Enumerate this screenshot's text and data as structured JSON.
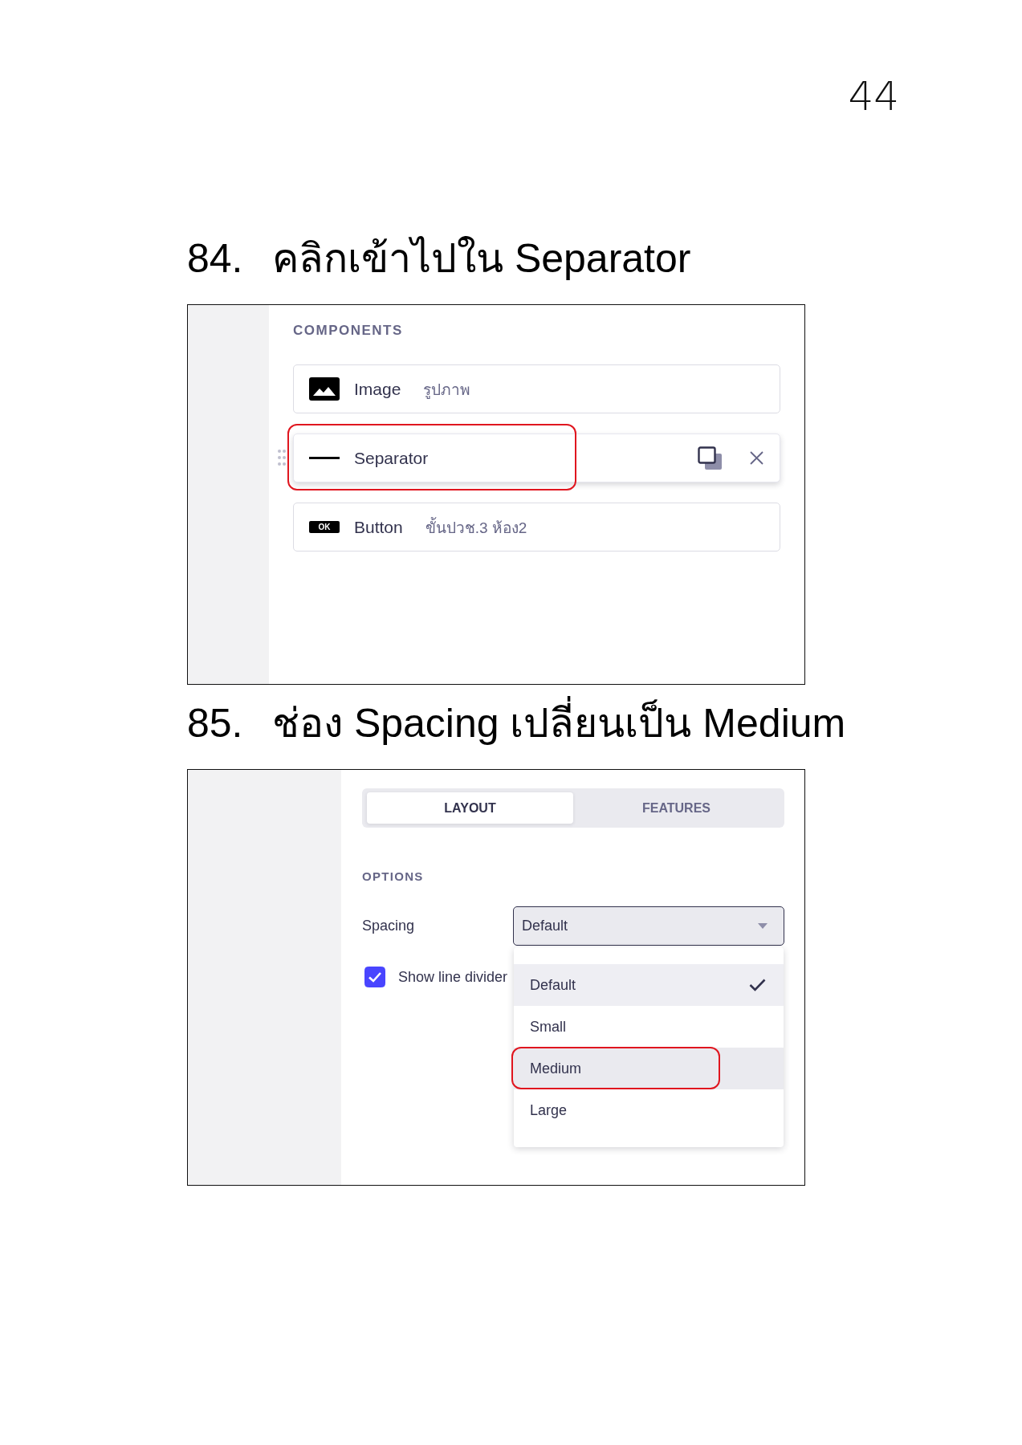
{
  "page_number": "44",
  "steps": [
    {
      "number": "84.",
      "instruction": "คลิกเข้าไปใน Separator",
      "screenshot": {
        "kind": "components",
        "section_title": "COMPONENTS",
        "components": [
          {
            "kind": "image",
            "name": "Image",
            "value": "รูปภาพ",
            "hovered": false,
            "annotated": false
          },
          {
            "kind": "separator",
            "name": "Separator",
            "hovered": true,
            "annotated": true
          },
          {
            "kind": "button",
            "badge": "OK",
            "name": "Button",
            "value": "ขั้นปวช.3 ห้อง2",
            "hovered": false,
            "annotated": false
          }
        ]
      }
    },
    {
      "number": "85.",
      "instruction": "ช่อง Spacing เปลี่ยนเป็น Medium",
      "screenshot": {
        "kind": "layout_settings",
        "tabs": [
          {
            "label": "LAYOUT",
            "selected": true
          },
          {
            "label": "FEATURES",
            "selected": false
          }
        ],
        "section_title": "OPTIONS",
        "spacing": {
          "label": "Spacing",
          "value": "Default",
          "expanded": true,
          "options": [
            {
              "label": "Default",
              "selected": true,
              "hovered": false,
              "annotated": false
            },
            {
              "label": "Small",
              "selected": false,
              "hovered": false,
              "annotated": false
            },
            {
              "label": "Medium",
              "selected": false,
              "hovered": true,
              "annotated": true
            },
            {
              "label": "Large",
              "selected": false,
              "hovered": false,
              "annotated": false
            }
          ]
        },
        "line_divider": {
          "label": "Show line divider",
          "checked": true
        }
      }
    }
  ]
}
